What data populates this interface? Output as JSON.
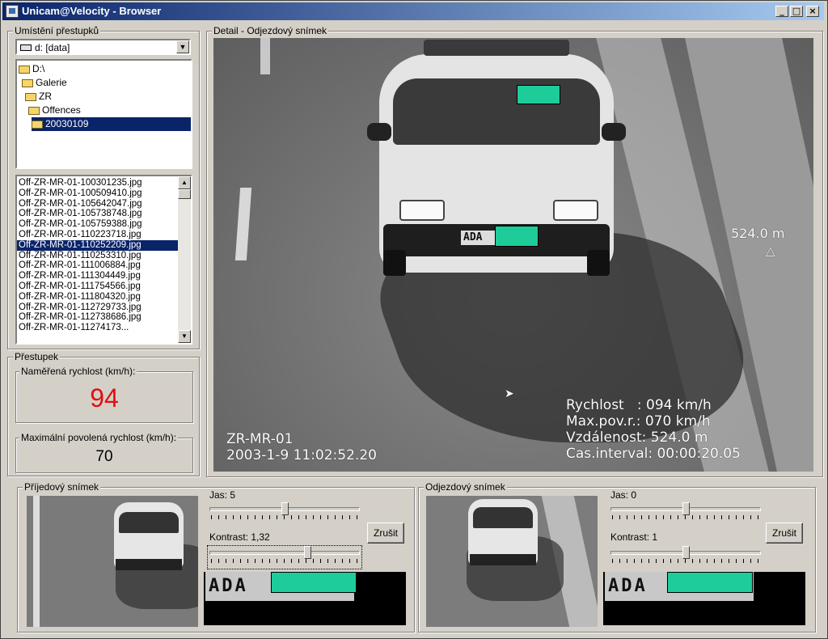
{
  "window": {
    "title": "Unicam@Velocity - Browser",
    "btn_min": "_",
    "btn_max": "□",
    "btn_close": "×"
  },
  "location": {
    "group_label": "Umístění přestupků",
    "drive": "d: [data]",
    "folders": [
      "D:\\",
      "Galerie",
      "ZR",
      "Offences",
      "20030109"
    ]
  },
  "files": [
    "Off-ZR-MR-01-100301235.jpg",
    "Off-ZR-MR-01-100509410.jpg",
    "Off-ZR-MR-01-105642047.jpg",
    "Off-ZR-MR-01-105738748.jpg",
    "Off-ZR-MR-01-105759388.jpg",
    "Off-ZR-MR-01-110223718.jpg",
    "Off-ZR-MR-01-110252209.jpg",
    "Off-ZR-MR-01-110253310.jpg",
    "Off-ZR-MR-01-111006884.jpg",
    "Off-ZR-MR-01-111304449.jpg",
    "Off-ZR-MR-01-111754566.jpg",
    "Off-ZR-MR-01-111804320.jpg",
    "Off-ZR-MR-01-112729733.jpg",
    "Off-ZR-MR-01-112738686.jpg",
    "Off-ZR-MR-01-11274173..."
  ],
  "selected_file_index": 6,
  "offence": {
    "group_label": "Přestupek",
    "measured_label": "Naměřená rychlost (km/h):",
    "measured_value": "94",
    "max_label": "Maximální povolená rychlost (km/h):",
    "max_value": "70"
  },
  "detail": {
    "group_label": "Detail - Odjezdový snímek",
    "distance_marker": "524.0 m",
    "marker_glyph": "△",
    "camera_id": "ZR-MR-01",
    "datetime": "2003-1-9 11:02:52.20",
    "info_lines": [
      "Rychlost   : 094 km/h",
      "Max.pov.r.: 070 km/h",
      "Vzdálenost: 524.0 m",
      "Cas.interval: 00:00:20.05"
    ],
    "plate_text": "ADA"
  },
  "arrival": {
    "group_label": "Příjedový snímek",
    "brightness_label": "Jas: 5",
    "brightness_level": 0.5,
    "contrast_label": "Kontrast: 1,32",
    "contrast_level": 0.66,
    "reset_label": "Zrušit",
    "plate_crop": "ADA"
  },
  "departure": {
    "group_label": "Odjezdový snímek",
    "brightness_label": "Jas: 0",
    "brightness_level": 0.5,
    "contrast_label": "Kontrast: 1",
    "contrast_level": 0.5,
    "reset_label": "Zrušit",
    "plate_crop": "ADA"
  },
  "colors": {
    "title_bar": "#0a246a",
    "selection": "#0a246a",
    "speed_red": "#e01010",
    "mask_green": "#1ecc9a"
  },
  "icons": [
    "app-icon",
    "drive-icon",
    "folder-icon",
    "cursor-icon"
  ]
}
